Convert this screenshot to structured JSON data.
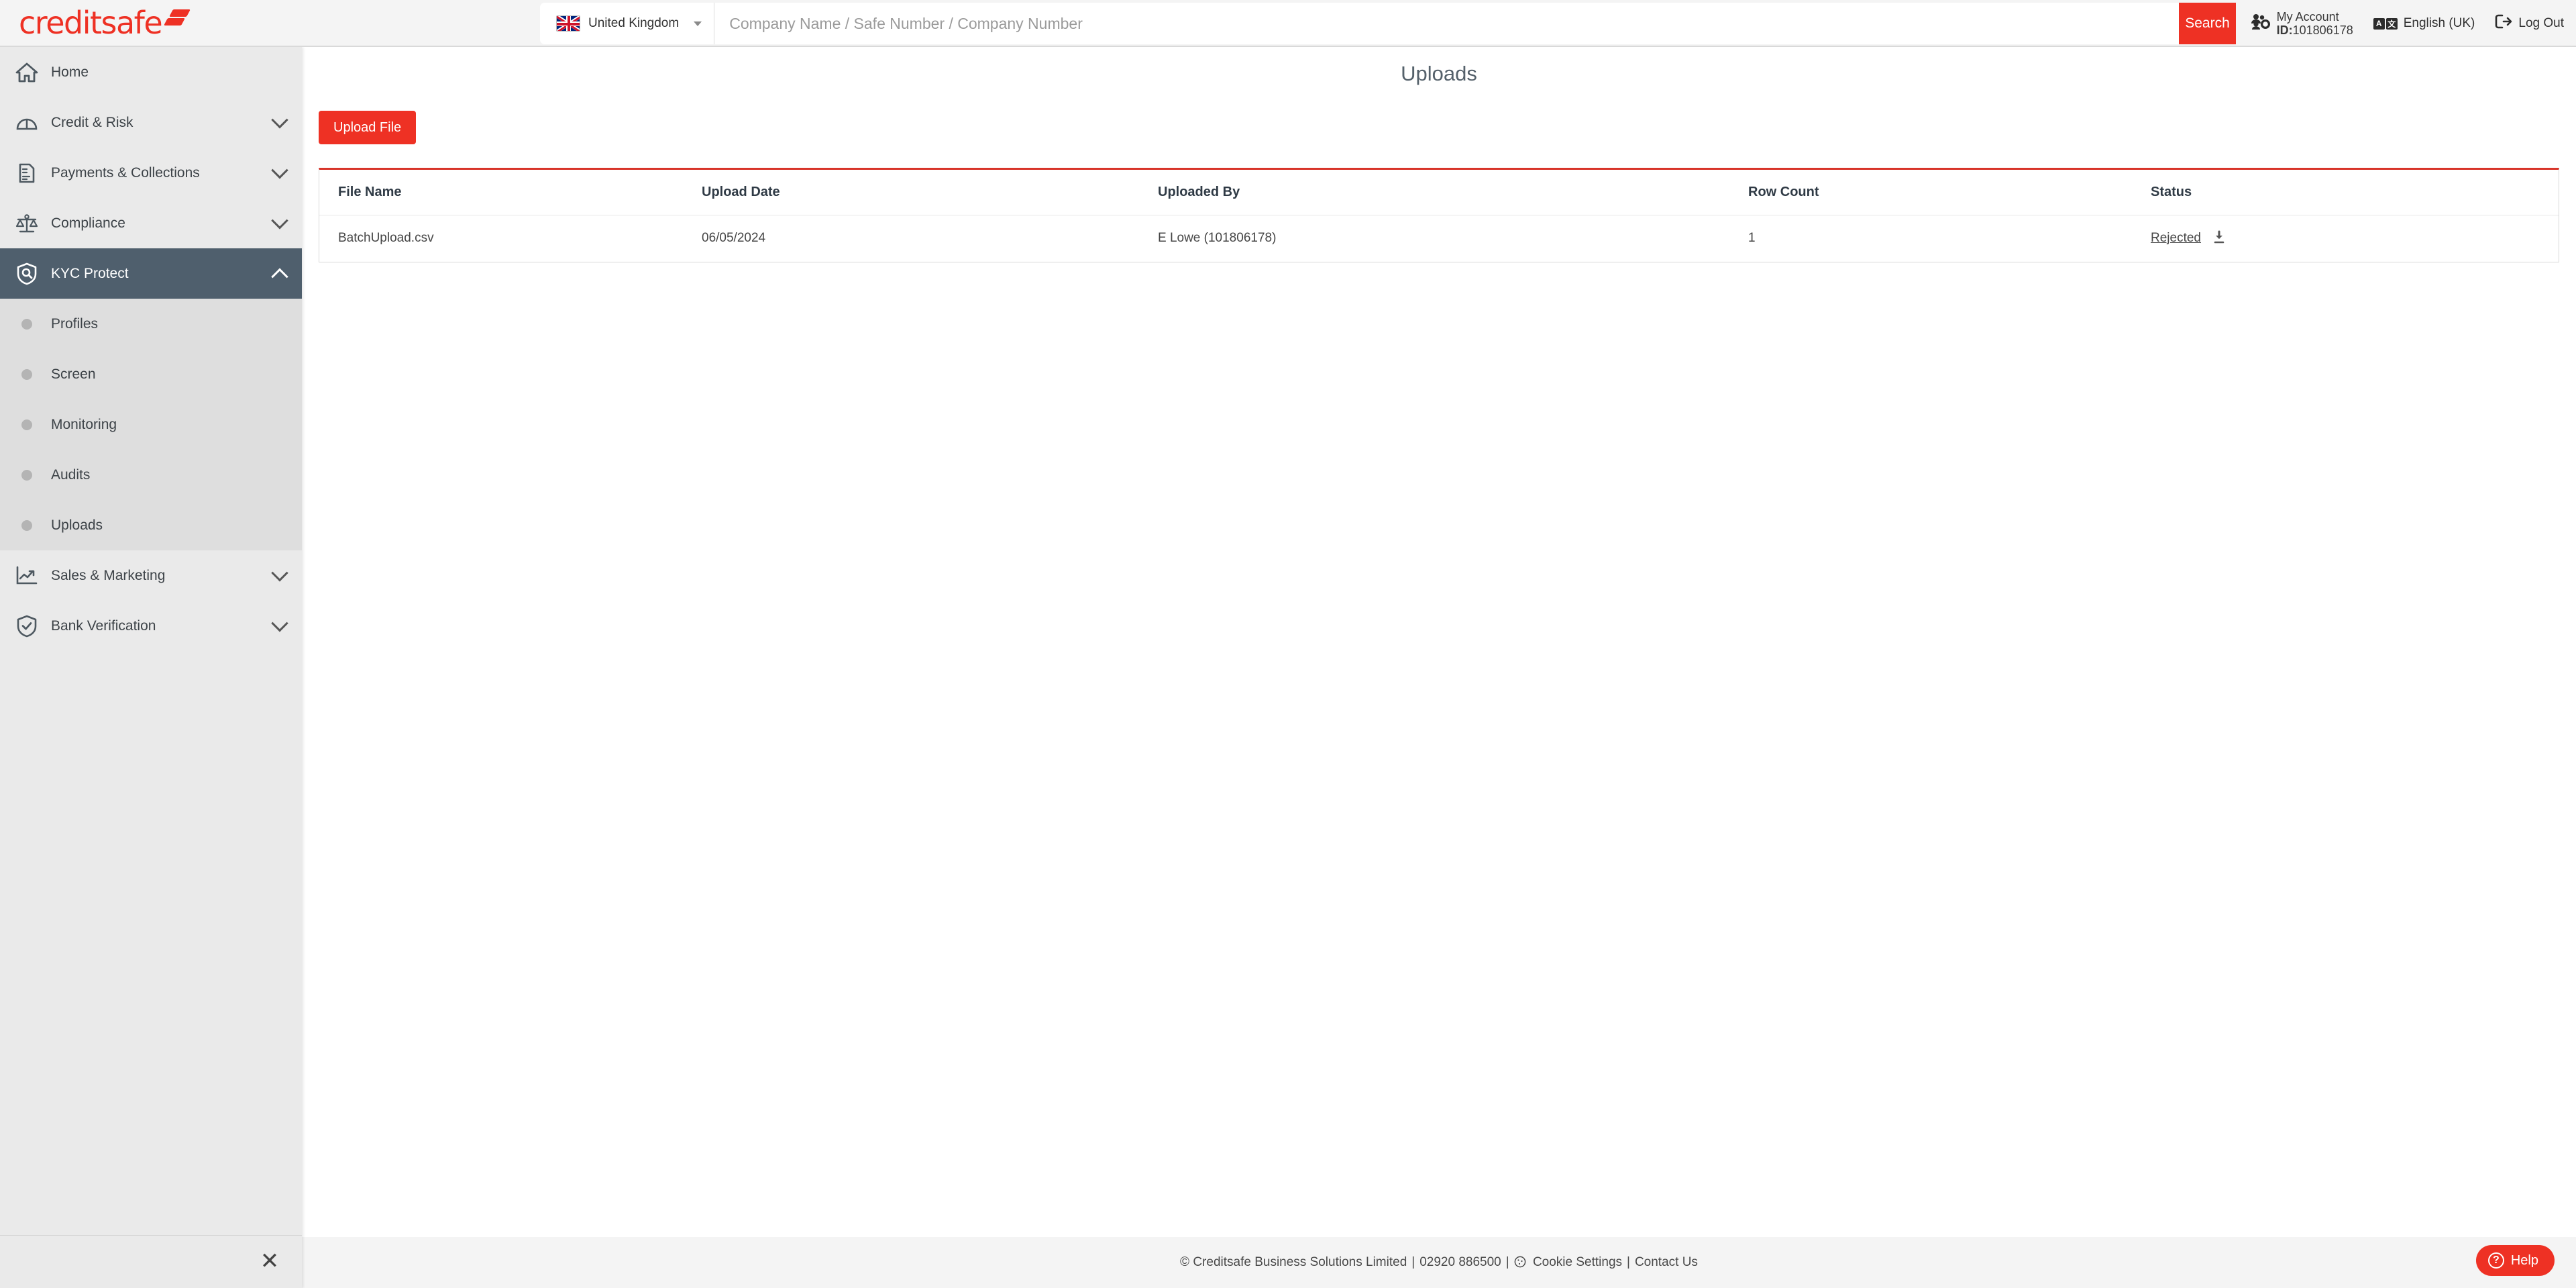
{
  "brand": {
    "logo_text": "creditsafe",
    "accent_red": "#ee3124",
    "table_top_border": "#d8352a",
    "sidebar_active_bg": "#4f5f6d"
  },
  "header": {
    "country": "United Kingdom",
    "search_placeholder": "Company Name / Safe Number / Company Number",
    "search_value": "",
    "search_button": "Search",
    "account_label": "My Account",
    "account_id": "ID:101806178",
    "account_id_prefix": "ID:",
    "account_id_number": "101806178",
    "language": "English (UK)",
    "lang_badge_a": "A",
    "lang_badge_b": "文",
    "logout": "Log Out"
  },
  "sidebar": {
    "items": [
      {
        "label": "Home",
        "icon": "home-icon",
        "expandable": false,
        "active": false
      },
      {
        "label": "Credit & Risk",
        "icon": "gauge-icon",
        "expandable": true,
        "active": false
      },
      {
        "label": "Payments & Collections",
        "icon": "document-icon",
        "expandable": true,
        "active": false
      },
      {
        "label": "Compliance",
        "icon": "scales-icon",
        "expandable": true,
        "active": false
      },
      {
        "label": "KYC Protect",
        "icon": "shield-search-icon",
        "expandable": true,
        "active": true
      },
      {
        "label": "Sales & Marketing",
        "icon": "chart-trend-icon",
        "expandable": true,
        "active": false
      },
      {
        "label": "Bank Verification",
        "icon": "shield-check-icon",
        "expandable": true,
        "active": false
      }
    ],
    "sub_items": [
      {
        "label": "Profiles"
      },
      {
        "label": "Screen"
      },
      {
        "label": "Monitoring"
      },
      {
        "label": "Audits"
      },
      {
        "label": "Uploads"
      }
    ],
    "close_glyph": "✕"
  },
  "main": {
    "title": "Uploads",
    "upload_button": "Upload File",
    "table": {
      "columns": [
        "File Name",
        "Upload Date",
        "Uploaded By",
        "Row Count",
        "Status"
      ],
      "rows": [
        {
          "file_name": "BatchUpload.csv",
          "upload_date": "06/05/2024",
          "uploaded_by": "E Lowe (101806178)",
          "row_count": "1",
          "status": "Rejected"
        }
      ]
    }
  },
  "footer": {
    "copyright": "© Creditsafe Business Solutions Limited",
    "sep1": "|",
    "phone": "02920 886500",
    "sep2": "|",
    "cookie_settings": "Cookie Settings",
    "sep3": "|",
    "contact_us": "Contact Us"
  },
  "help": {
    "label": "Help",
    "glyph": "?"
  }
}
